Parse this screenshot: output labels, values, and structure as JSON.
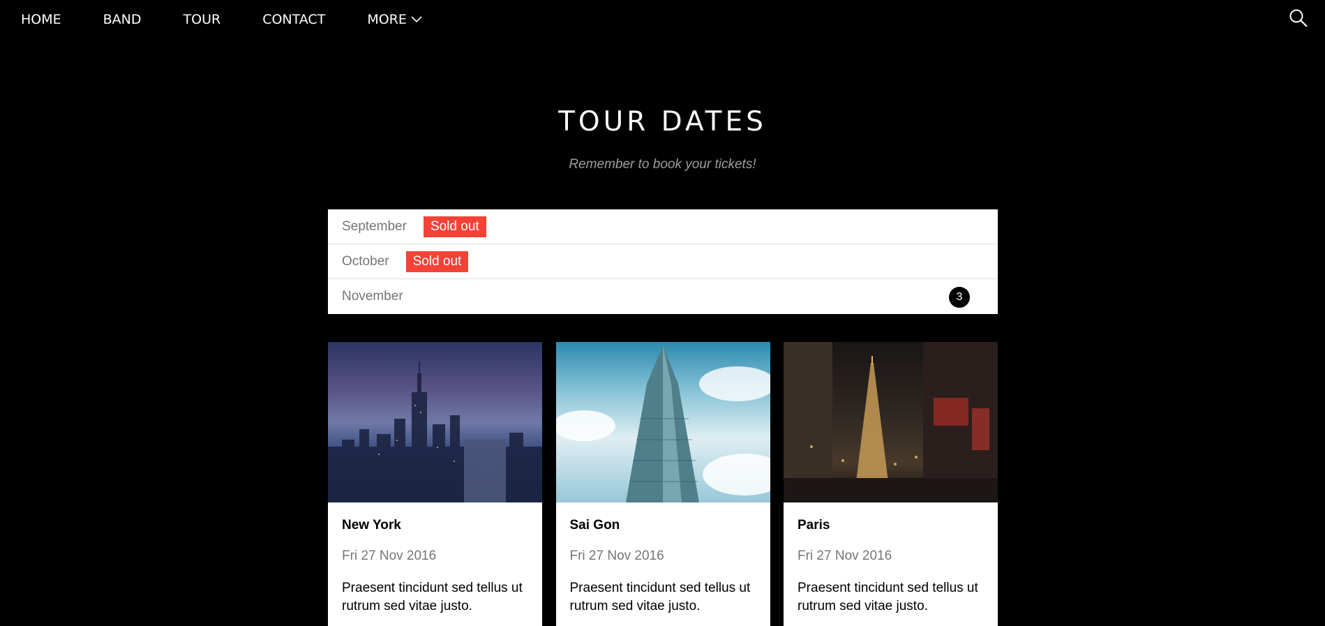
{
  "nav": {
    "items": [
      {
        "label": "HOME"
      },
      {
        "label": "BAND"
      },
      {
        "label": "TOUR"
      },
      {
        "label": "CONTACT"
      },
      {
        "label": "MORE"
      }
    ]
  },
  "tour": {
    "title": "TOUR DATES",
    "subtitle": "Remember to book your tickets!",
    "months": [
      {
        "name": "September",
        "badge": "Sold out"
      },
      {
        "name": "October",
        "badge": "Sold out"
      },
      {
        "name": "November",
        "count": "3"
      }
    ],
    "cards": [
      {
        "city": "New York",
        "date": "Fri 27 Nov 2016",
        "desc": "Praesent tincidunt sed tellus ut rutrum sed vitae justo."
      },
      {
        "city": "Sai Gon",
        "date": "Fri 27 Nov 2016",
        "desc": "Praesent tincidunt sed tellus ut rutrum sed vitae justo."
      },
      {
        "city": "Paris",
        "date": "Fri 27 Nov 2016",
        "desc": "Praesent tincidunt sed tellus ut rutrum sed vitae justo."
      }
    ]
  },
  "colors": {
    "background": "#000000",
    "sold_out": "#f44336",
    "muted_text": "#757575"
  },
  "icons": {
    "search": "search-icon",
    "more": "chevron-down-icon"
  }
}
